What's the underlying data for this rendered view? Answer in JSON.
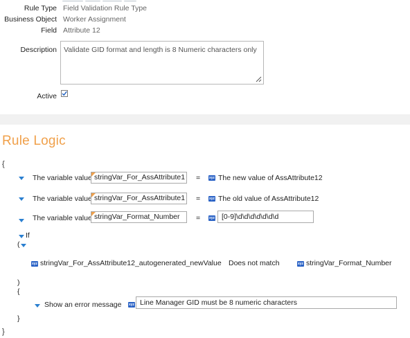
{
  "properties": {
    "rule_type_label": "Rule Type",
    "rule_type_value": "Field Validation Rule Type",
    "business_object_label": "Business Object",
    "business_object_value": "Worker Assignment",
    "field_label": "Field",
    "field_value": "Attribute 12",
    "description_label": "Description",
    "description_value": "Validate GID format and length is 8 Numeric characters only",
    "active_label": "Active",
    "active_checked": true
  },
  "rule_logic": {
    "title": "Rule Logic",
    "open_brace": "{",
    "close_brace": "}",
    "statements": [
      {
        "prefix": "The variable value",
        "variable": "stringVar_For_AssAttribute1",
        "operator": "=",
        "icon": "xyz",
        "value": "The new value of AssAttribute12"
      },
      {
        "prefix": "The variable value",
        "variable": "stringVar_For_AssAttribute1",
        "operator": "=",
        "icon": "xyz",
        "value": "The old value of AssAttribute12"
      },
      {
        "prefix": "The variable value",
        "variable": "stringVar_Format_Number",
        "operator": "=",
        "icon": "xyz",
        "value": "[0-9]\\d\\d\\d\\d\\d\\d\\d"
      }
    ],
    "if_block": {
      "keyword": "If",
      "open_paren": "(",
      "left_operand": "stringVar_For_AssAttribute12_autogenerated_newValue",
      "comparator": "Does not match",
      "right_operand": "stringVar_Format_Number",
      "close_paren": ")",
      "open_brace": "{",
      "action_label": "Show an error message",
      "message": "Line Manager GID must be 8 numeric characters",
      "close_brace": "}"
    }
  },
  "icons": {
    "xyz_text": "xyz"
  },
  "colors": {
    "accent_orange": "#f0a04a",
    "expand_blue": "#2a7fd0",
    "xyz_badge_blue": "#2b63c6"
  }
}
